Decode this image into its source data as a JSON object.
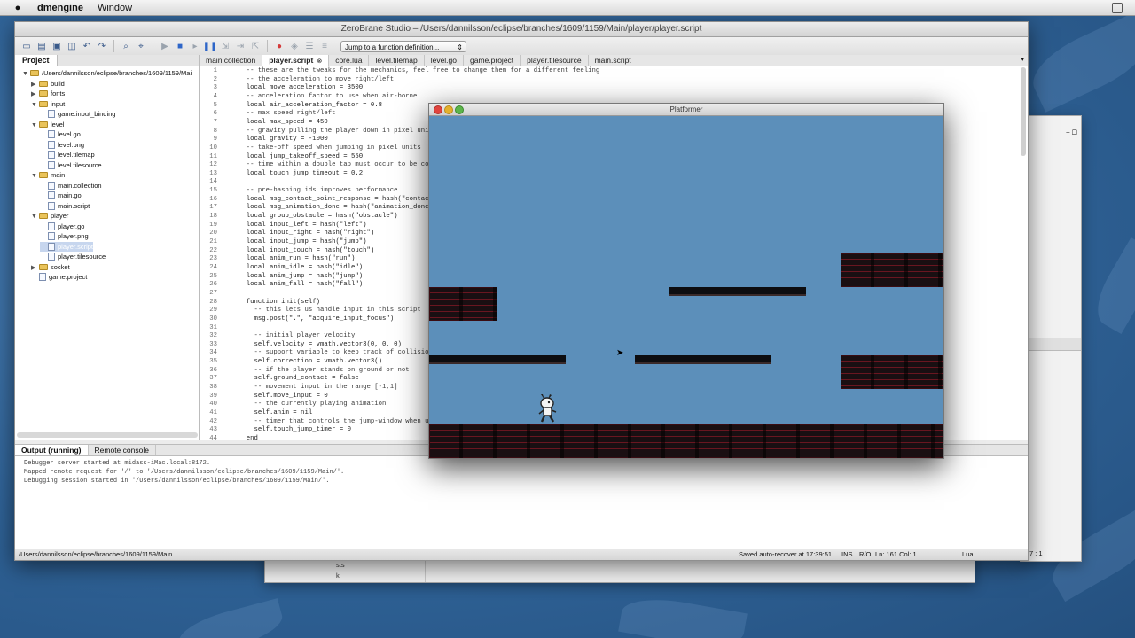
{
  "menubar": {
    "app": "dmengine",
    "items": [
      "Window"
    ]
  },
  "ide": {
    "title": "ZeroBrane Studio – /Users/dannilsson/eclipse/branches/1609/1159/Main/player/player.script",
    "jump_placeholder": "Jump to a function definition...",
    "project_tab": "Project",
    "tree": [
      {
        "label": "/Users/dannilsson/eclipse/branches/1609/1159/Mai",
        "type": "folder",
        "depth": 0,
        "open": true
      },
      {
        "label": "build",
        "type": "folder",
        "depth": 1,
        "open": false
      },
      {
        "label": "fonts",
        "type": "folder",
        "depth": 1,
        "open": false
      },
      {
        "label": "input",
        "type": "folder",
        "depth": 1,
        "open": true
      },
      {
        "label": "game.input_binding",
        "type": "file",
        "depth": 2
      },
      {
        "label": "level",
        "type": "folder",
        "depth": 1,
        "open": true
      },
      {
        "label": "level.go",
        "type": "file",
        "depth": 2
      },
      {
        "label": "level.png",
        "type": "file",
        "depth": 2
      },
      {
        "label": "level.tilemap",
        "type": "file",
        "depth": 2
      },
      {
        "label": "level.tilesource",
        "type": "file",
        "depth": 2
      },
      {
        "label": "main",
        "type": "folder",
        "depth": 1,
        "open": true
      },
      {
        "label": "main.collection",
        "type": "file",
        "depth": 2
      },
      {
        "label": "main.go",
        "type": "file",
        "depth": 2
      },
      {
        "label": "main.script",
        "type": "file",
        "depth": 2
      },
      {
        "label": "player",
        "type": "folder",
        "depth": 1,
        "open": true
      },
      {
        "label": "player.go",
        "type": "file",
        "depth": 2
      },
      {
        "label": "player.png",
        "type": "file",
        "depth": 2
      },
      {
        "label": "player.script",
        "type": "file",
        "depth": 2,
        "selected": true
      },
      {
        "label": "player.tilesource",
        "type": "file",
        "depth": 2
      },
      {
        "label": "socket",
        "type": "folder",
        "depth": 1,
        "open": false
      },
      {
        "label": "game.project",
        "type": "file",
        "depth": 1
      }
    ],
    "tabs": [
      {
        "label": "main.collection"
      },
      {
        "label": "player.script",
        "active": true
      },
      {
        "label": "core.lua"
      },
      {
        "label": "level.tilemap"
      },
      {
        "label": "level.go"
      },
      {
        "label": "game.project"
      },
      {
        "label": "player.tilesource"
      },
      {
        "label": "main.script"
      }
    ],
    "tab_close": "⊗",
    "code": [
      "  -- these are the tweaks for the mechanics, feel free to change them for a different feeling",
      "  -- the acceleration to move right/left",
      "  local move_acceleration = 3500",
      "  -- acceleration factor to use when air-borne",
      "  local air_acceleration_factor = 0.8",
      "  -- max speed right/left",
      "  local max_speed = 450",
      "  -- gravity pulling the player down in pixel units",
      "  local gravity = -1000",
      "  -- take-off speed when jumping in pixel units",
      "  local jump_takeoff_speed = 550",
      "  -- time within a double tap must occur to be cons",
      "  local touch_jump_timeout = 0.2",
      "",
      "  -- pre-hashing ids improves performance",
      "  local msg_contact_point_response = hash(\"contact_p",
      "  local msg_animation_done = hash(\"animation_done\")",
      "  local group_obstacle = hash(\"obstacle\")",
      "  local input_left = hash(\"left\")",
      "  local input_right = hash(\"right\")",
      "  local input_jump = hash(\"jump\")",
      "  local input_touch = hash(\"touch\")",
      "  local anim_run = hash(\"run\")",
      "  local anim_idle = hash(\"idle\")",
      "  local anim_jump = hash(\"jump\")",
      "  local anim_fall = hash(\"fall\")",
      "",
      "  function init(self)",
      "    -- this lets us handle input in this script",
      "    msg.post(\".\", \"acquire_input_focus\")",
      "",
      "    -- initial player velocity",
      "    self.velocity = vmath.vector3(0, 0, 0)",
      "    -- support variable to keep track of collisions",
      "    self.correction = vmath.vector3()",
      "    -- if the player stands on ground or not",
      "    self.ground_contact = false",
      "    -- movement input in the range [-1,1]",
      "    self.move_input = 0",
      "    -- the currently playing animation",
      "    self.anim = nil",
      "    -- timer that controls the jump-window when usi",
      "    self.touch_jump_timer = 0",
      "  end"
    ],
    "output_tabs": [
      {
        "label": "Output (running)",
        "active": true
      },
      {
        "label": "Remote console"
      }
    ],
    "output_lines": [
      "Debugger server started at midass-iMac.local:8172.",
      "Mapped remote request for '/' to '/Users/dannilsson/eclipse/branches/1609/1159/Main/'.",
      "Debugging session started in '/Users/dannilsson/eclipse/branches/1609/1159/Main/'."
    ],
    "status": {
      "path": "/Users/dannilsson/eclipse/branches/1609/1159/Main",
      "saved": "Saved auto-recover at 17:39:51.",
      "ins": "INS",
      "ro": "R/O",
      "pos": "Ln: 161 Col: 1",
      "lang": "Lua"
    }
  },
  "background": {
    "status_right": "7 : 1",
    "bottom_lines": [
      "sts",
      "k"
    ]
  },
  "game": {
    "title": "Platformer",
    "sky_color": "#5c8fba",
    "colors": {
      "tile_dark": "#1a0f12",
      "tile_red": "#6a1620",
      "slab": "#0d0d10"
    }
  },
  "colors": {
    "desktop": "#2f6296",
    "selection": "#c7d6ee",
    "folder": "#e9c35a"
  }
}
